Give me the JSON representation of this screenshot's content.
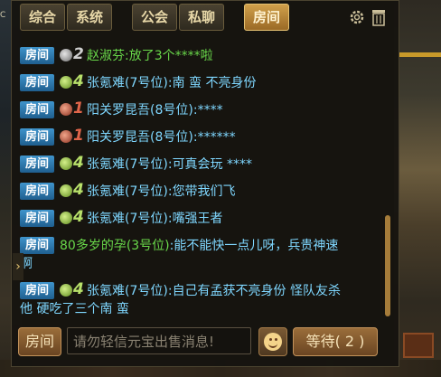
{
  "tabs": [
    "综合",
    "系统",
    "公会",
    "私聊",
    "房间"
  ],
  "active_tab": 4,
  "background": {
    "left_fragment": "C"
  },
  "messages": [
    {
      "channel": "房间",
      "rank_num": "2",
      "rank_color": "gray",
      "name": "赵淑芬",
      "name_color": "#69d84a",
      "sep": ":",
      "text": "放了3个****啦",
      "text_color": "#69d84a"
    },
    {
      "channel": "房间",
      "rank_num": "4",
      "rank_color": "green",
      "name": "张氪难(7号位)",
      "name_color": "#7fd7ff",
      "sep": ":",
      "text": "南 蛮 不亮身份",
      "text_color": "#7fd7ff"
    },
    {
      "channel": "房间",
      "rank_num": "1",
      "rank_color": "red",
      "name": "阳关罗昆吾(8号位)",
      "name_color": "#7fd7ff",
      "sep": ":",
      "text": "****",
      "text_color": "#7fd7ff"
    },
    {
      "channel": "房间",
      "rank_num": "1",
      "rank_color": "red",
      "name": "阳关罗昆吾(8号位)",
      "name_color": "#7fd7ff",
      "sep": ":",
      "text": "******",
      "text_color": "#7fd7ff"
    },
    {
      "channel": "房间",
      "rank_num": "4",
      "rank_color": "green",
      "name": "张氪难(7号位)",
      "name_color": "#7fd7ff",
      "sep": ":",
      "text": "可真会玩 ****",
      "text_color": "#7fd7ff"
    },
    {
      "channel": "房间",
      "rank_num": "4",
      "rank_color": "green",
      "name": "张氪难(7号位)",
      "name_color": "#7fd7ff",
      "sep": ":",
      "text": "您带我们飞",
      "text_color": "#7fd7ff"
    },
    {
      "channel": "房间",
      "rank_num": "4",
      "rank_color": "green",
      "name": "张氪难(7号位)",
      "name_color": "#7fd7ff",
      "sep": ":",
      "text": "嘴强王者",
      "text_color": "#7fd7ff"
    },
    {
      "channel": "房间",
      "rank_num": "",
      "rank_color": "",
      "name": "80多岁的孕(3号位)",
      "name_color": "#69d84a",
      "sep": ":",
      "text": "能不能快一点儿呀，兵贵神速",
      "text_cont": "啊",
      "text_color": "#7fd7ff"
    },
    {
      "channel": "房间",
      "rank_num": "4",
      "rank_color": "green",
      "name": "张氪难(7号位)",
      "name_color": "#7fd7ff",
      "sep": ":",
      "text": "自己有孟获不亮身份 怪队友杀",
      "text_cont": "他 硬吃了三个南 蛮",
      "text_color": "#7fd7ff"
    }
  ],
  "input": {
    "room_button": "房间",
    "placeholder": "请勿轻信元宝出售消息!",
    "wait_button": "等待( 2 )"
  },
  "colors": {
    "active_tab": "#c48f3c",
    "channel_badge": "#2f7fb8",
    "rank_green": "#b8e06a",
    "rank_red": "#e0654a"
  }
}
